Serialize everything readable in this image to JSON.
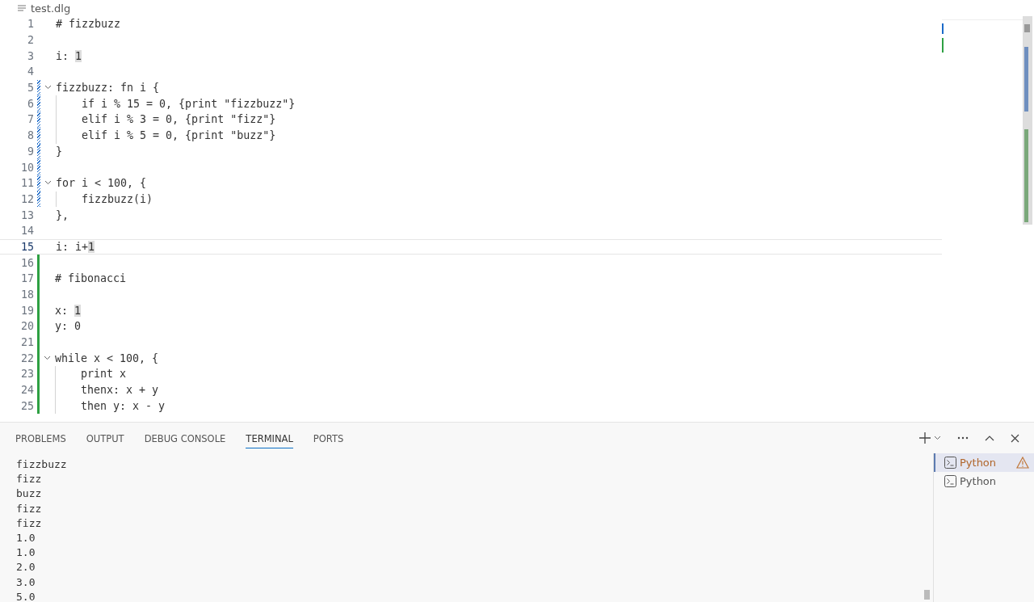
{
  "editor": {
    "file_name": "test.dlg",
    "lines": [
      {
        "number": "1",
        "segments": [
          {
            "text": "# fizzbuzz"
          }
        ]
      },
      {
        "number": "2"
      },
      {
        "number": "3",
        "segments": [
          {
            "text": "i: "
          },
          {
            "text": "1",
            "highlighted": true
          }
        ]
      },
      {
        "number": "4"
      },
      {
        "number": "5",
        "expanded": true,
        "modified": true,
        "segments": [
          {
            "text": "fizzbuzz: fn i {"
          }
        ]
      },
      {
        "number": "6",
        "modified": true,
        "guide": true,
        "segments": [
          {
            "text": "    if i % 15 = 0, {print \"fizzbuzz\"}"
          }
        ]
      },
      {
        "number": "7",
        "modified": true,
        "guide": true,
        "segments": [
          {
            "text": "    elif i % 3 = 0, {print \"fizz\"}"
          }
        ]
      },
      {
        "number": "8",
        "modified": true,
        "guide": true,
        "segments": [
          {
            "text": "    elif i % 5 = 0, {print \"buzz\"}"
          }
        ]
      },
      {
        "number": "9",
        "modified": true,
        "segments": [
          {
            "text": "}"
          }
        ]
      },
      {
        "number": "10",
        "modified": true
      },
      {
        "number": "11",
        "expanded": true,
        "modified": true,
        "segments": [
          {
            "text": "for i < 100, {"
          }
        ]
      },
      {
        "number": "12",
        "modified": true,
        "guide": true,
        "segments": [
          {
            "text": "    fizzbuzz(i)"
          }
        ]
      },
      {
        "number": "13",
        "segments": [
          {
            "text": "},"
          }
        ]
      },
      {
        "number": "14"
      },
      {
        "number": "15",
        "selected": true,
        "segments": [
          {
            "text": "i: i+"
          },
          {
            "text": "1",
            "highlighted": true
          }
        ]
      },
      {
        "number": "16",
        "added": true
      },
      {
        "number": "17",
        "added": true,
        "segments": [
          {
            "text": "# fibonacci"
          }
        ]
      },
      {
        "number": "18",
        "added": true
      },
      {
        "number": "19",
        "added": true,
        "segments": [
          {
            "text": "x: "
          },
          {
            "text": "1",
            "highlighted": true
          }
        ]
      },
      {
        "number": "20",
        "added": true,
        "segments": [
          {
            "text": "y: 0"
          }
        ]
      },
      {
        "number": "21",
        "added": true
      },
      {
        "number": "22",
        "expanded": true,
        "added": true,
        "segments": [
          {
            "text": "while x < 100, {"
          }
        ]
      },
      {
        "number": "23",
        "added": true,
        "guide": true,
        "segments": [
          {
            "text": "    print x"
          }
        ]
      },
      {
        "number": "24",
        "added": true,
        "guide": true,
        "segments": [
          {
            "text": "    thenx: x + y"
          }
        ]
      },
      {
        "number": "25",
        "added": true,
        "guide": true,
        "segments": [
          {
            "text": "    then y: x - y"
          }
        ]
      }
    ]
  },
  "panel": {
    "tabs": [
      {
        "label": "PROBLEMS",
        "selected": false
      },
      {
        "label": "OUTPUT",
        "selected": false
      },
      {
        "label": "DEBUG CONSOLE",
        "selected": false
      },
      {
        "label": "TERMINAL",
        "selected": true
      },
      {
        "label": "PORTS",
        "selected": false
      }
    ],
    "output": [
      "fizzbuzz",
      "fizz",
      "buzz",
      "fizz",
      "fizz",
      "1.0",
      "1.0",
      "2.0",
      "3.0",
      "5.0"
    ],
    "terminals": [
      {
        "label": "Python",
        "selected": true,
        "warning": true
      },
      {
        "label": "Python",
        "selected": false,
        "warning": false
      }
    ]
  }
}
